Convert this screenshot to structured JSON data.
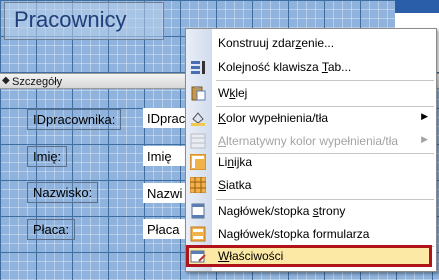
{
  "form": {
    "title": "Pracownicy",
    "section_label": "Szczegóły",
    "fields": [
      {
        "label": "IDpracownika:",
        "value": "IDprac"
      },
      {
        "label": "Imię:",
        "value": "Imię"
      },
      {
        "label": "Nazwisko:",
        "value": "Nazwi"
      },
      {
        "label": "Płaca:",
        "value": "Płaca"
      }
    ]
  },
  "menu": {
    "items": {
      "konstruuj": {
        "pre": "Konstruuj zdar",
        "u": "z",
        "post": "enie..."
      },
      "kolejnosc": {
        "pre": "Kolejność klawisza ",
        "u": "T",
        "post": "ab..."
      },
      "wklej": {
        "pre": "W",
        "u": "k",
        "post": "lej"
      },
      "kolor": {
        "pre": "",
        "u": "K",
        "post": "olor wypełnienia/tła"
      },
      "alternatywny": {
        "pre": "",
        "u": "A",
        "post": "lternatywny kolor wypełnienia/tła"
      },
      "linijka": {
        "pre": "Li",
        "u": "n",
        "post": "ijka"
      },
      "siatka": {
        "pre": "",
        "u": "S",
        "post": "iatka"
      },
      "naglowek_strony": {
        "pre": "Nagłówek/stopka ",
        "u": "s",
        "post": "trony"
      },
      "naglowek_formularza": {
        "pre": "Na",
        "u": "g",
        "post": "łówek/stopka formularza"
      },
      "wlasciwosci": {
        "pre": "",
        "u": "W",
        "post": "łaściwości"
      }
    },
    "submenu_arrow": "▶"
  },
  "colors": {
    "surface": "#8fb3dc",
    "highlight_border": "#b0141b",
    "highlight_fill": "#fde9a6",
    "title_text": "#1f3e7a"
  }
}
